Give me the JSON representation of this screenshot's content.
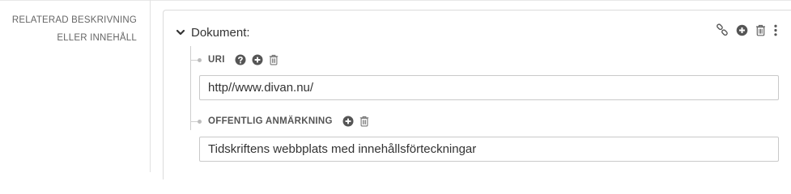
{
  "field": {
    "label_line1": "RELATERAD BESKRIVNING",
    "label_line2": "ELLER INNEHÅLL"
  },
  "card": {
    "title": "Dokument:",
    "actions": [
      "link-icon",
      "plus-circle-icon",
      "trash-icon",
      "more-vertical-icon"
    ]
  },
  "rows": [
    {
      "label": "URI",
      "icons": [
        "help-icon",
        "plus-circle-icon",
        "trash-icon"
      ],
      "value": "http//www.divan.nu/"
    },
    {
      "label": "OFFENTLIG ANMÄRKNING",
      "icons": [
        "plus-circle-icon",
        "trash-icon"
      ],
      "value": "Tidskriftens webbplats med innehållsförteckningar"
    }
  ],
  "colors": {
    "icon": "#555555",
    "border": "#c9c9c9",
    "label": "#666666"
  }
}
